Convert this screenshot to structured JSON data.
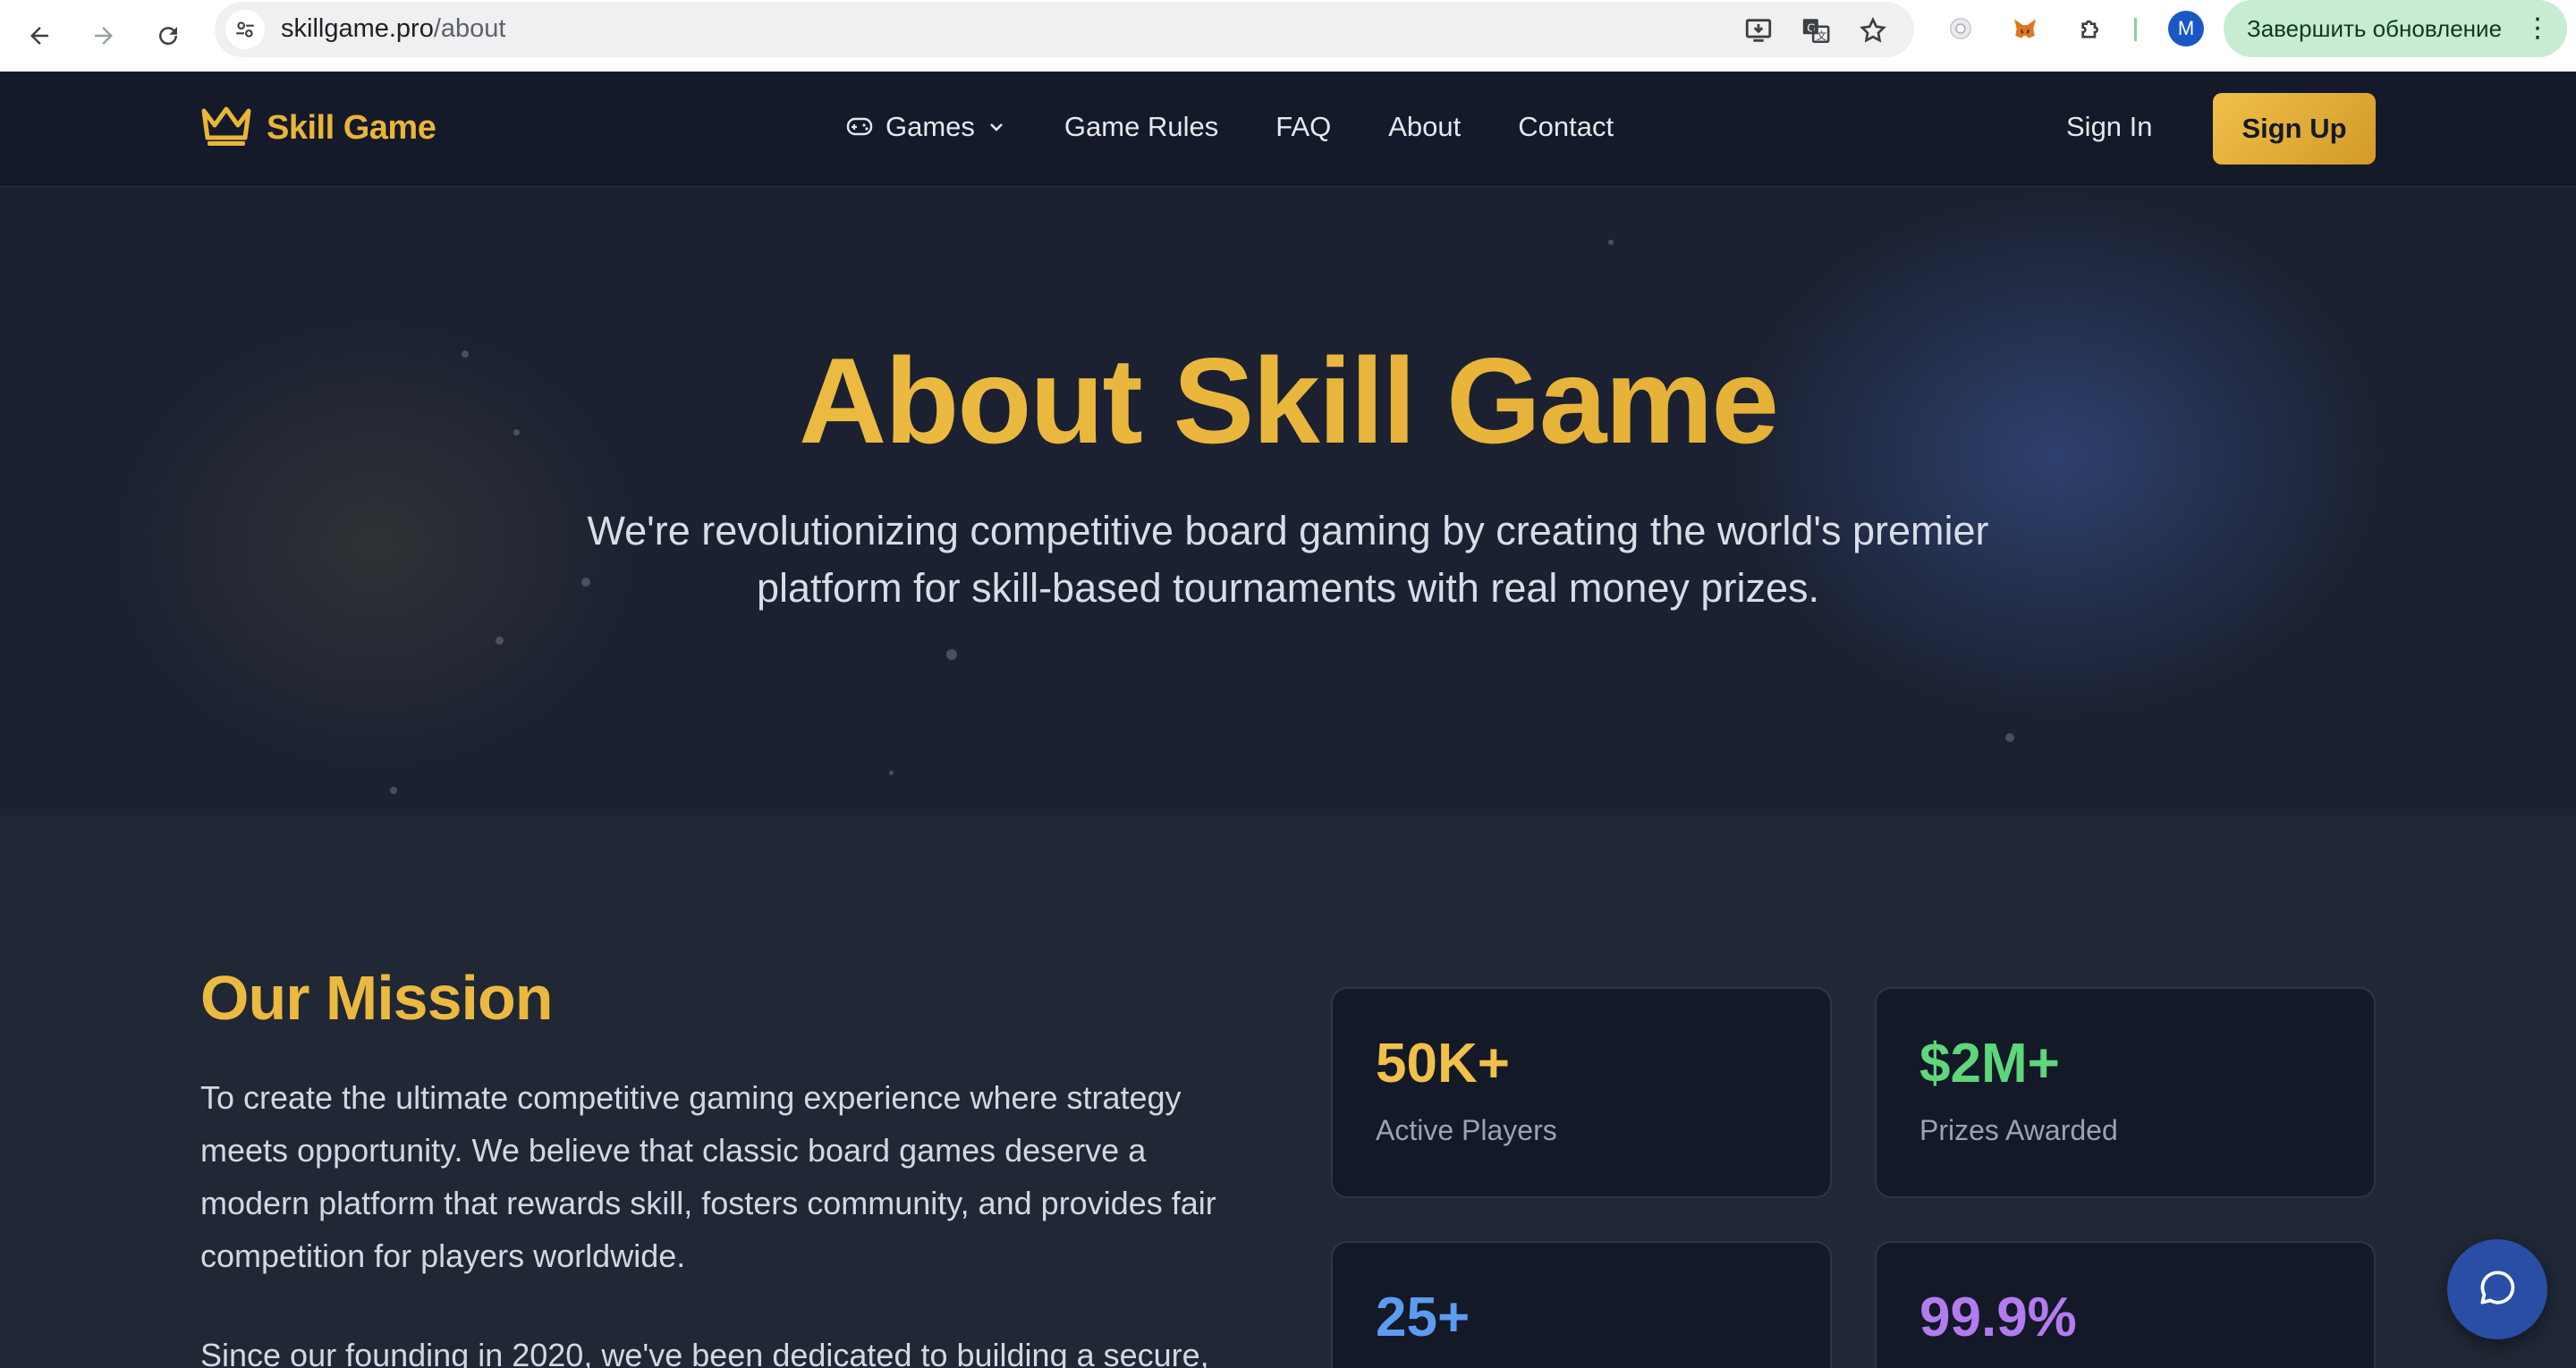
{
  "browser": {
    "url_host": "skillgame.pro",
    "url_path": "/about",
    "profile_initial": "M",
    "update_button": "Завершить обновление"
  },
  "header": {
    "logo_text": "Skill Game",
    "menu": [
      {
        "label": "Games",
        "has_dropdown": true,
        "icon": "gamepad-icon"
      },
      {
        "label": "Game Rules"
      },
      {
        "label": "FAQ"
      },
      {
        "label": "About"
      },
      {
        "label": "Contact"
      }
    ],
    "sign_in": "Sign In",
    "sign_up": "Sign Up"
  },
  "hero": {
    "title": "About Skill Game",
    "subtitle": "We're revolutionizing competitive board gaming by creating the world's premier platform for skill-based tournaments with real money prizes."
  },
  "mission": {
    "title": "Our Mission",
    "paragraph": "To create the ultimate competitive gaming experience where strategy meets opportunity. We believe that classic board games deserve a modern platform that rewards skill, fosters community, and provides fair competition for players worldwide.",
    "paragraph2_visible": "Since our founding in 2020, we've been dedicated to building a secure,"
  },
  "stats": [
    {
      "value": "50K+",
      "label": "Active Players",
      "color": "#f0c04a"
    },
    {
      "value": "$2M+",
      "label": "Prizes Awarded",
      "color": "#5fd57c"
    },
    {
      "value": "25+",
      "label": "",
      "color": "#5c9cf0"
    },
    {
      "value": "99.9%",
      "label": "",
      "color": "#b27cf0"
    }
  ],
  "colors": {
    "accent": "#e9b53a",
    "header_bg": "#141a29",
    "page_bg": "#202735"
  }
}
